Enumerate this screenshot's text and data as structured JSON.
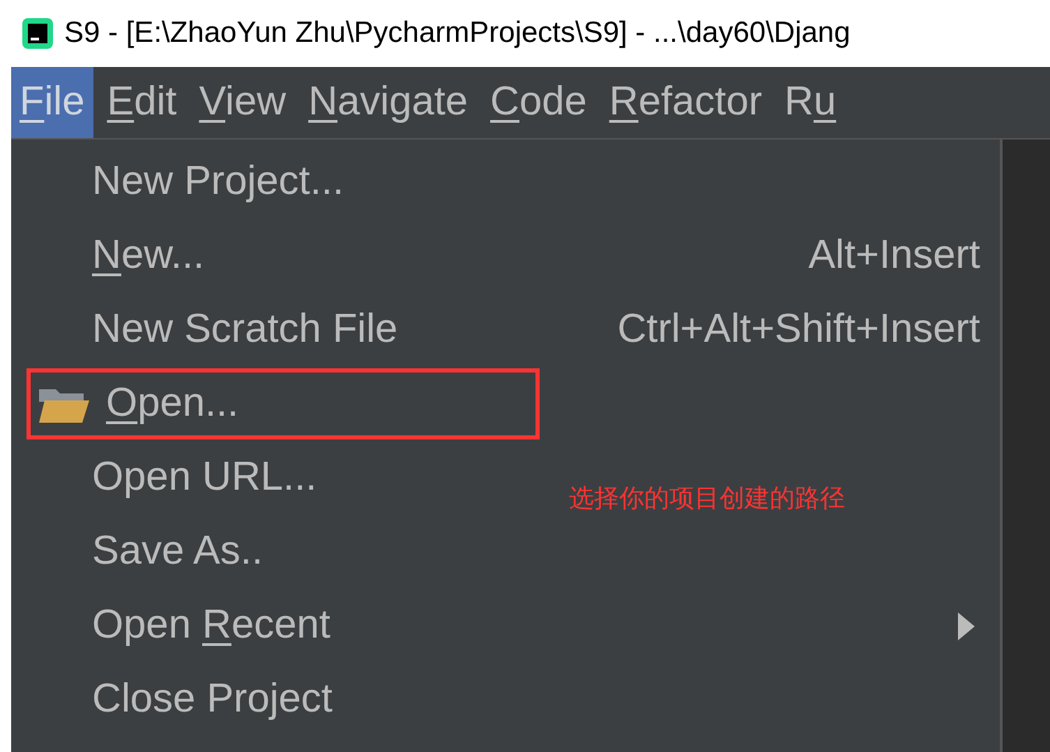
{
  "window": {
    "title": "S9 - [E:\\ZhaoYun Zhu\\PycharmProjects\\S9] - ...\\day60\\Djang"
  },
  "menu_bar": [
    {
      "mnemonic": "F",
      "after": "ile",
      "selected": true
    },
    {
      "mnemonic": "E",
      "after": "dit",
      "selected": false
    },
    {
      "mnemonic": "V",
      "after": "iew",
      "selected": false
    },
    {
      "mnemonic": "N",
      "after": "avigate",
      "selected": false
    },
    {
      "mnemonic": "C",
      "after": "ode",
      "selected": false
    },
    {
      "mnemonic": "R",
      "after": "efactor",
      "selected": false
    },
    {
      "before": "R",
      "mnemonic": "u",
      "selected": false
    }
  ],
  "file_menu": [
    {
      "before": "New Project...",
      "highlighted": false
    },
    {
      "mnemonic": "N",
      "after": "ew...",
      "shortcut": "Alt+Insert",
      "highlighted": false
    },
    {
      "before": "New Scratch File",
      "shortcut": "Ctrl+Alt+Shift+Insert",
      "highlighted": false
    },
    {
      "mnemonic": "O",
      "after": "pen...",
      "folder_icon": true,
      "highlighted": true
    },
    {
      "before": "Open URL...",
      "highlighted": false
    },
    {
      "before": "Save As..",
      "highlighted": false
    },
    {
      "before": "Open ",
      "mnemonic": "R",
      "after": "ecent",
      "submenu": true,
      "highlighted": false
    },
    {
      "before": "Close Project",
      "highlighted": false
    }
  ],
  "annotation": "选择你的项目创建的路径"
}
